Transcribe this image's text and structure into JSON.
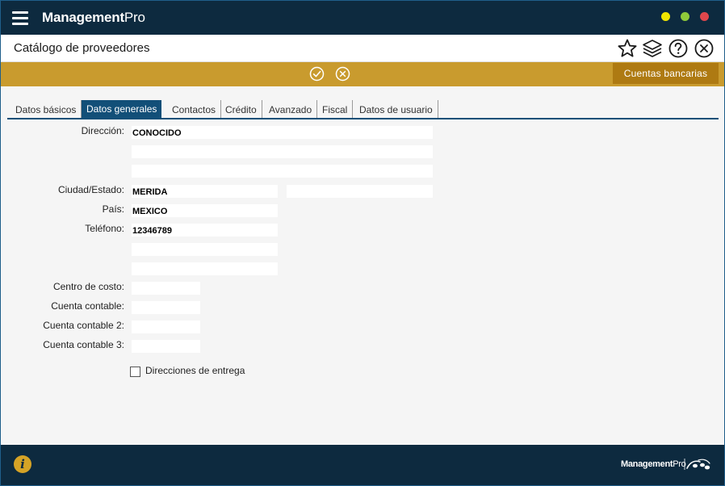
{
  "app": {
    "brand_bold": "Management",
    "brand_light": "Pro"
  },
  "header": {
    "title": "Catálogo de proveedores"
  },
  "actionbar": {
    "bank_button": "Cuentas bancarias"
  },
  "tabs": [
    {
      "label": "Datos básicos"
    },
    {
      "label": "Datos generales"
    },
    {
      "label": "Contactos"
    },
    {
      "label": "Crédito"
    },
    {
      "label": "Avanzado"
    },
    {
      "label": "Fiscal"
    },
    {
      "label": "Datos de usuario"
    }
  ],
  "form": {
    "direccion_label": "Dirección:",
    "direccion_1": "CONOCIDO",
    "direccion_2": "",
    "direccion_3": "",
    "ciudad_label": "Ciudad/Estado:",
    "ciudad": "MERIDA",
    "estado": "",
    "pais_label": "País:",
    "pais": "MEXICO",
    "telefono_label": "Teléfono:",
    "telefono_1": "12346789",
    "telefono_2": "",
    "telefono_3": "",
    "centro_costo_label": "Centro de costo:",
    "centro_costo": "",
    "cuenta_contable_label": "Cuenta contable:",
    "cuenta_contable": "",
    "cuenta_contable_2_label": "Cuenta contable 2:",
    "cuenta_contable_2": "",
    "cuenta_contable_3_label": "Cuenta contable 3:",
    "cuenta_contable_3": "",
    "direcciones_entrega_label": "Direcciones de entrega"
  },
  "footer": {
    "brand_bold": "Management",
    "brand_light": "Pro",
    "info_glyph": "i"
  },
  "colors": {
    "titlebar": "#0d2a3f",
    "actionbar": "#c99b2e",
    "tab_active": "#124f78",
    "bank_button": "#ae7a12"
  },
  "icons": [
    "menu-icon",
    "star-icon",
    "layers-icon",
    "help-icon",
    "close-circle-icon",
    "confirm-icon",
    "cancel-icon",
    "info-icon"
  ]
}
